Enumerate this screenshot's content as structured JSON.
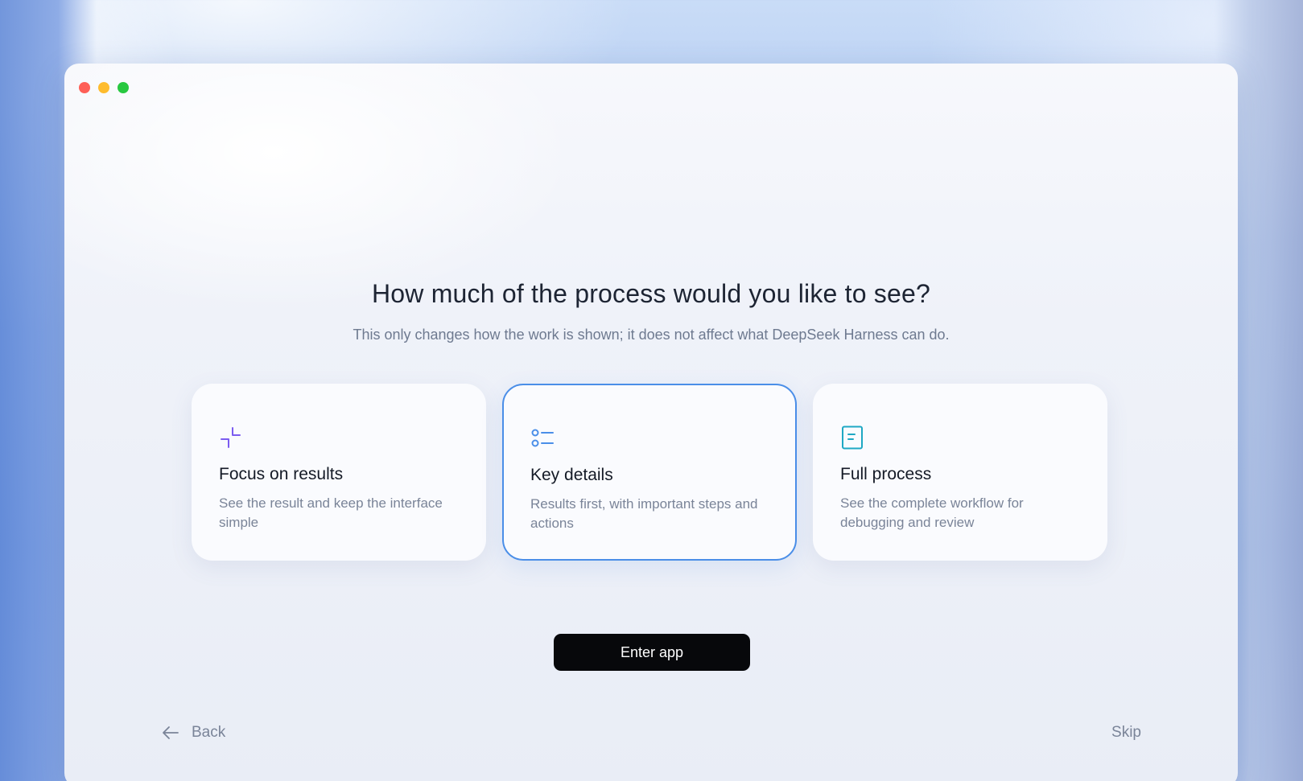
{
  "window": {
    "controls": [
      "close",
      "minimize",
      "maximize"
    ]
  },
  "onboarding": {
    "question": "How much of the process would you like to see?",
    "subtitle": "This only changes how the work is shown; it does not affect what DeepSeek Harness can do.",
    "options": [
      {
        "title": "Focus on results",
        "description": "See the result and keep the interface simple",
        "icon": "collapse-icon",
        "selected": false
      },
      {
        "title": "Key details",
        "description": "Results first, with important steps and actions",
        "icon": "list-icon",
        "selected": true
      },
      {
        "title": "Full process",
        "description": "See the complete workflow for debugging and review",
        "icon": "document-icon",
        "selected": false
      }
    ],
    "enter_label": "Enter app",
    "back_label": "Back",
    "skip_label": "Skip"
  },
  "colors": {
    "selected_border": "#4a8ee8",
    "focus_icon": "#7b5cf0",
    "details_icon": "#4a8ee8",
    "process_icon": "#1fa8c4",
    "button_bg": "#07080b"
  }
}
